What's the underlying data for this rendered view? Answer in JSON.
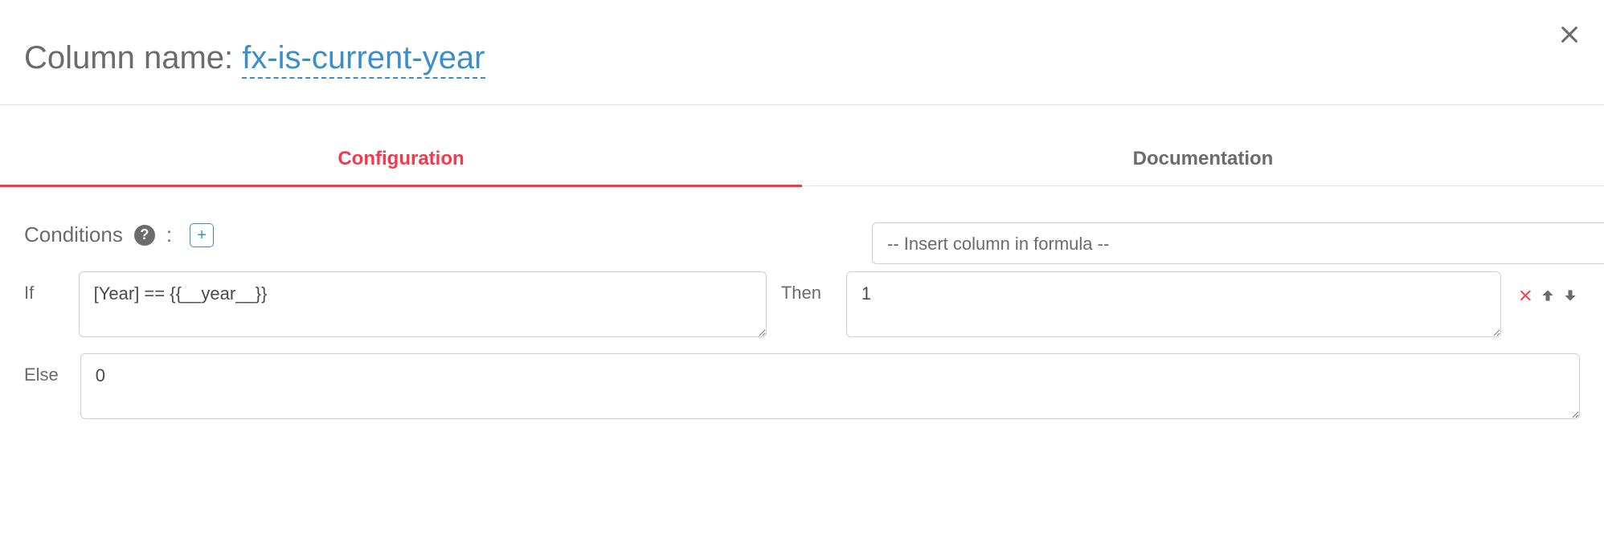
{
  "header": {
    "label": "Column name: ",
    "column_name": "fx-is-current-year"
  },
  "tabs": {
    "configuration": "Configuration",
    "documentation": "Documentation"
  },
  "conditions": {
    "label": "Conditions",
    "colon": ":",
    "add_label": "+"
  },
  "insert_select": {
    "placeholder": "-- Insert column in formula --"
  },
  "rules": [
    {
      "if_label": "If",
      "if_value": "[Year] == {{__year__}}",
      "then_label": "Then",
      "then_value": "1"
    }
  ],
  "else": {
    "label": "Else",
    "value": "0"
  },
  "colors": {
    "accent": "#3b8fc9",
    "danger": "#f33a4c",
    "text": "#6b6b6b"
  }
}
